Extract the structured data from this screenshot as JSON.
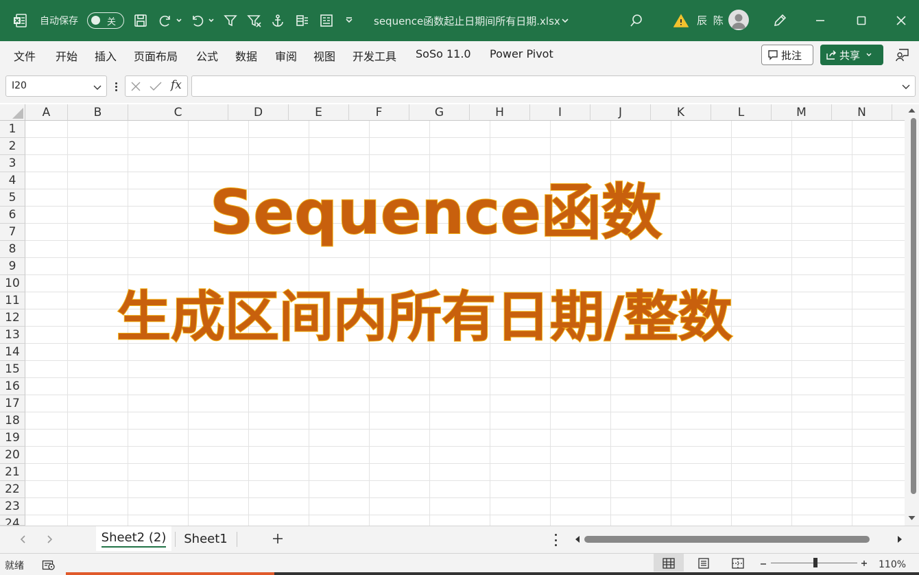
{
  "titlebar": {
    "autosave_label": "自动保存",
    "autosave_state": "关",
    "document_title": "sequence函数起止日期间所有日期.xlsx",
    "user_name": "辰 陈"
  },
  "ribbon": {
    "tabs": [
      "文件",
      "开始",
      "插入",
      "页面布局",
      "公式",
      "数据",
      "审阅",
      "视图",
      "开发工具",
      "SoSo 11.0",
      "Power Pivot"
    ],
    "comments_label": "批注",
    "share_label": "共享"
  },
  "formula_bar": {
    "name_box": "I20",
    "fx_label": "fx",
    "formula": ""
  },
  "grid": {
    "columns": [
      "A",
      "B",
      "C",
      "D",
      "E",
      "F",
      "G",
      "H",
      "I",
      "J",
      "K",
      "L",
      "M",
      "N"
    ],
    "rows": [
      "1",
      "2",
      "3",
      "4",
      "5",
      "6",
      "7",
      "8",
      "9",
      "10",
      "11",
      "12",
      "13",
      "14",
      "15",
      "16",
      "17",
      "18",
      "19",
      "20",
      "21",
      "22",
      "23",
      "24"
    ]
  },
  "overlay": {
    "line1": "Sequence函数",
    "line2": "生成区间内所有日期/整数",
    "fill_color": "#c8600d",
    "outline_color": "#f2b21a"
  },
  "sheets": {
    "tabs": [
      "Sheet2 (2)",
      "Sheet1"
    ],
    "active_index": 0
  },
  "status": {
    "text": "就绪",
    "zoom": "110%"
  },
  "colors": {
    "excel_green": "#217346",
    "share_green": "#1e7145"
  }
}
